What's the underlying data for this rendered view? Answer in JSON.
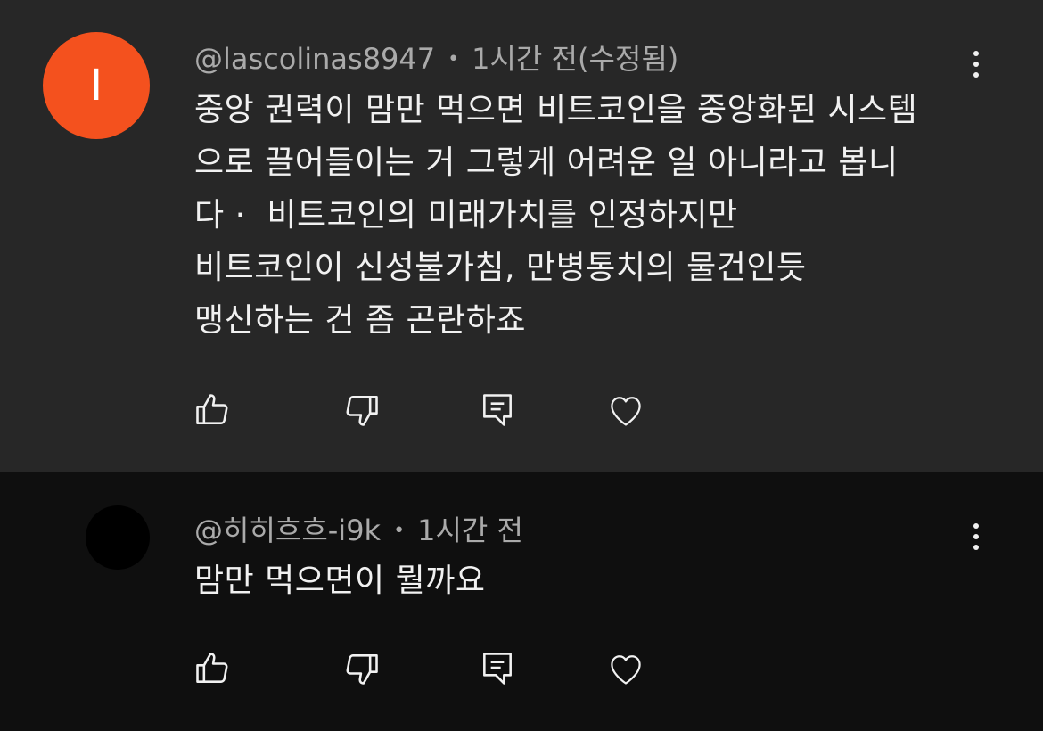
{
  "comments": [
    {
      "avatar_letter": "I",
      "avatar_color": "#f4511e",
      "username": "@lascolinas8947",
      "separator": "•",
      "time": "1시간 전(수정됨)",
      "text": "중앙 권력이 맘만 먹으면 비트코인을 중앙화된 시스템\n으로 끌어들이는 거 그렇게 어려운 일 아니라고 봅니\n다 ·  비트코인의 미래가치를 인정하지만\n비트코인이 신성불가침, 만병통치의 물건인듯\n맹신하는 건 좀 곤란하죠",
      "icons": [
        "thumbs-up-icon",
        "thumbs-down-icon",
        "reply-icon",
        "heart-icon",
        "more-vert-icon"
      ]
    },
    {
      "avatar_color": "#000000",
      "username": "@히히흐흐-i9k",
      "separator": "•",
      "time": "1시간 전",
      "text": "맘만 먹으면이 뭘까요",
      "icons": [
        "thumbs-up-icon",
        "thumbs-down-icon",
        "reply-icon",
        "heart-icon",
        "more-vert-icon"
      ]
    }
  ],
  "colors": {
    "background_highlight": "#272727",
    "background": "#0f0f0f",
    "text_primary": "#f1f1f1",
    "text_secondary": "#aaaaaa"
  }
}
